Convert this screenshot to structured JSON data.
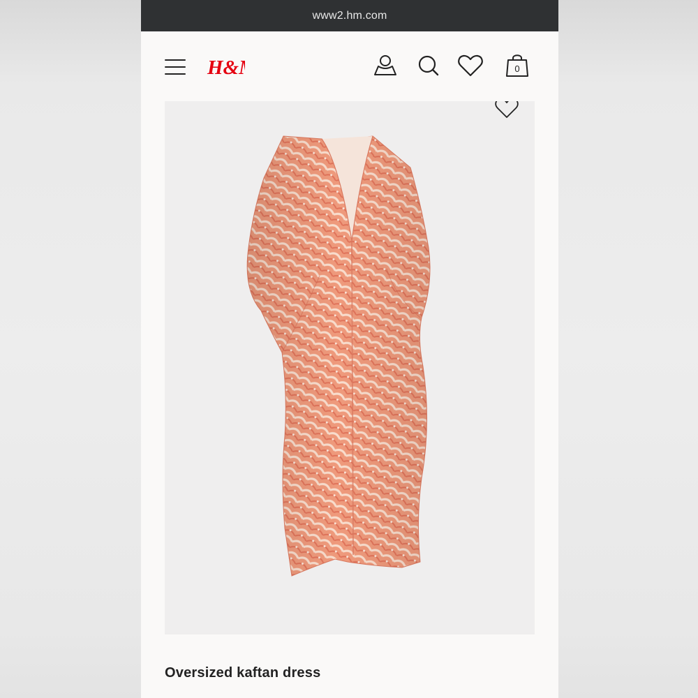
{
  "browser": {
    "url": "www2.hm.com"
  },
  "header": {
    "logo_text": "H&M",
    "icons": [
      "menu-icon",
      "account-icon",
      "search-icon",
      "favorites-heart-icon",
      "shopping-bag-icon"
    ],
    "bag_count": "0",
    "brand_color": "#e50010"
  },
  "product": {
    "title": "Oversized kaftan dress",
    "image_alt": "Orange patterned oversized kaftan dress",
    "image_bg": "#efeeee",
    "dress_color": "#f2a68a"
  }
}
